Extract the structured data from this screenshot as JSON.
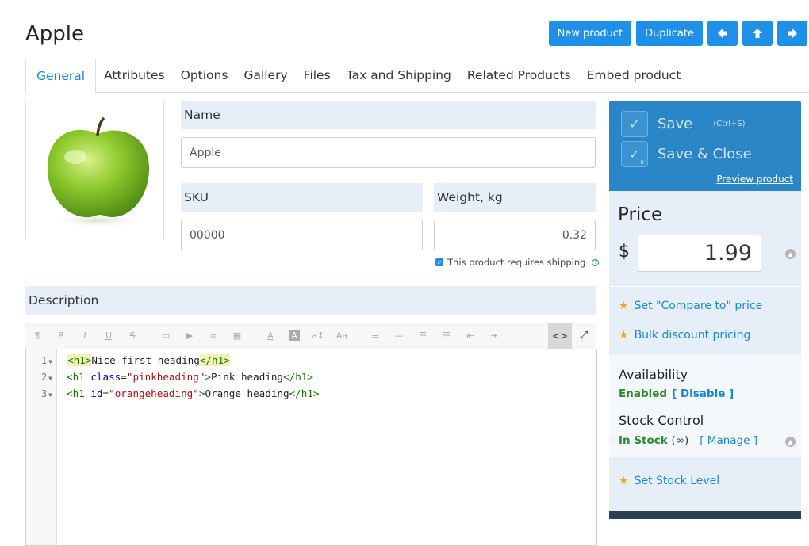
{
  "page": {
    "title": "Apple"
  },
  "top_buttons": {
    "new_product": "New product",
    "duplicate": "Duplicate"
  },
  "icons": {
    "prev": "arrow-left-icon",
    "up": "arrow-up-icon",
    "next": "arrow-right-icon"
  },
  "tabs": [
    {
      "label": "General",
      "active": true
    },
    {
      "label": "Attributes"
    },
    {
      "label": "Options"
    },
    {
      "label": "Gallery"
    },
    {
      "label": "Files"
    },
    {
      "label": "Tax and Shipping"
    },
    {
      "label": "Related Products"
    },
    {
      "label": "Embed product"
    }
  ],
  "form": {
    "name_label": "Name",
    "name_value": "Apple",
    "sku_label": "SKU",
    "sku_value": "00000",
    "weight_label": "Weight, kg",
    "weight_value": "0.32",
    "shipping_text": "This product requires shipping",
    "shipping_checked": true,
    "description_label": "Description"
  },
  "editor": {
    "line_numbers": [
      "1",
      "2",
      "3"
    ],
    "lines": [
      {
        "open": "<h1>",
        "text": "Nice first heading",
        "close": "</h1>"
      },
      {
        "open_start": "<h1",
        "attr": "class",
        "value": "\"pinkheading\"",
        "open_end": ">",
        "text": "Pink heading",
        "close": "</h1>"
      },
      {
        "open_start": "<h1",
        "attr": "id",
        "value": "\"orangeheading\"",
        "open_end": ">",
        "text": "Orange heading",
        "close": "</h1>"
      }
    ],
    "toolbar_glyphs": {
      "paragraph": "¶",
      "bold": "B",
      "italic": "I",
      "underline": "U",
      "strike": "S",
      "image": "▭",
      "video": "▶",
      "link": "∞",
      "table": "▦",
      "font_color": "A",
      "bg_color": "A",
      "font_size": "a↕",
      "font_family": "Aa",
      "align": "≡",
      "hr": "—",
      "ul": "☰",
      "ol": "☰",
      "outdent": "⇤",
      "indent": "⇥",
      "code": "<>",
      "fullscreen": "⤢"
    }
  },
  "sidebar": {
    "save": "Save",
    "save_hint": "(Ctrl+S)",
    "save_close": "Save & Close",
    "save_close_mark": "x",
    "preview": "Preview product",
    "price_heading": "Price",
    "currency": "$",
    "price_value": "1.99",
    "compare_link": "Set \"Compare to\" price",
    "bulk_link": "Bulk discount pricing",
    "availability_heading": "Availability",
    "availability_status": "Enabled",
    "availability_action": "[ Disable ]",
    "stock_heading": "Stock Control",
    "stock_status": "In Stock",
    "stock_infinity": "(∞)",
    "stock_action": "[ Manage ]",
    "stock_level_link": "Set Stock Level"
  },
  "colors": {
    "accent": "#1e90e8",
    "sidebar_top": "#2a86c6",
    "label_bg": "#e6eff8",
    "status_green": "#2d8a2d"
  }
}
